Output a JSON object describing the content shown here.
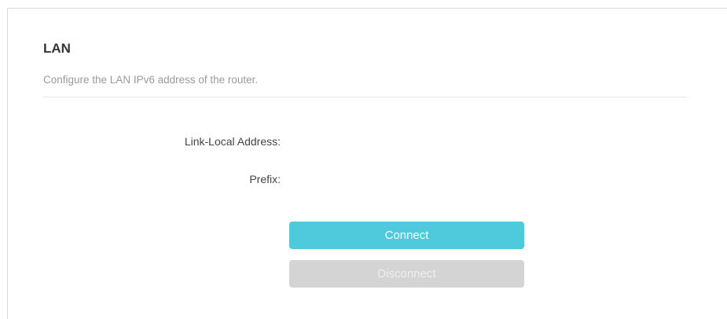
{
  "section": {
    "title": "LAN",
    "description": "Configure the LAN IPv6 address of the router."
  },
  "fields": {
    "link_local": {
      "label": "Link-Local Address:",
      "value": ""
    },
    "prefix": {
      "label": "Prefix:",
      "value": ""
    }
  },
  "buttons": {
    "connect_label": "Connect",
    "disconnect_label": "Disconnect"
  },
  "colors": {
    "accent": "#4fc9dc",
    "disabled": "#d4d4d4"
  }
}
